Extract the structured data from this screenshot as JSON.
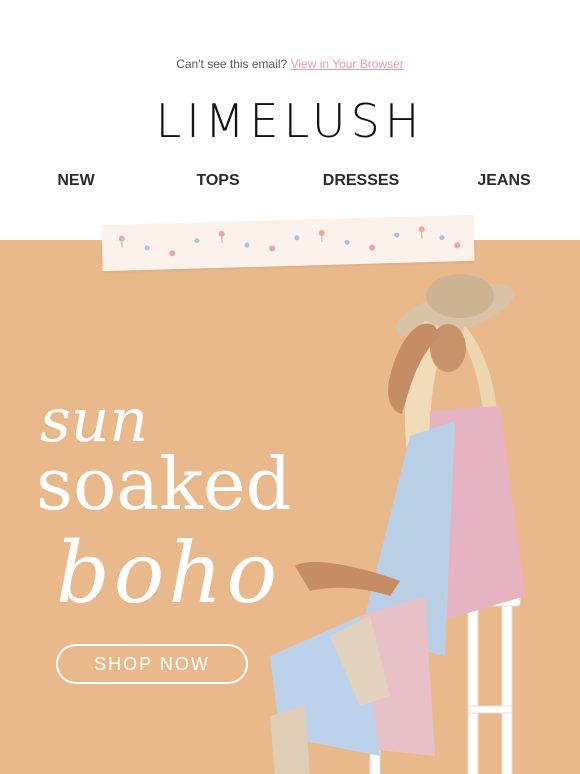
{
  "preheader": {
    "text": "Can't see this email?",
    "link": "View in Your Browser"
  },
  "brand": {
    "logo": "LIMELUSH"
  },
  "nav": {
    "items": [
      "NEW",
      "TOPS",
      "DRESSES",
      "JEANS"
    ]
  },
  "hero": {
    "headline": [
      "sun",
      "soaked",
      "boho"
    ],
    "cta": "SHOP NOW",
    "background_color": "#e9b98c"
  }
}
